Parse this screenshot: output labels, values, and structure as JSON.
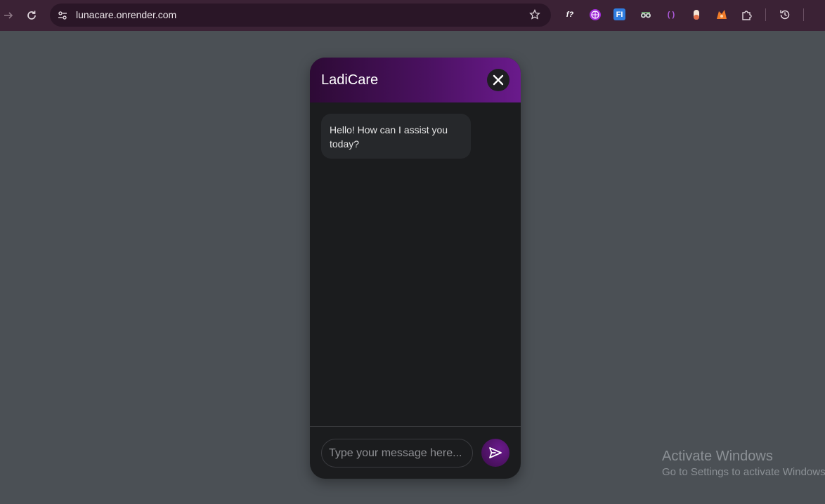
{
  "browser": {
    "url": "lunacare.onrender.com",
    "extensions": [
      {
        "icon": "formula-ext-icon",
        "label": "f?"
      },
      {
        "icon": "globe-ext-icon",
        "label": ""
      },
      {
        "icon": "fi-ext-icon",
        "label": "FI"
      },
      {
        "icon": "spy-ext-icon",
        "label": ""
      },
      {
        "icon": "brackets-ext-icon",
        "label": "( )"
      },
      {
        "icon": "pill-ext-icon",
        "label": ""
      },
      {
        "icon": "fox-ext-icon",
        "label": ""
      }
    ]
  },
  "chat": {
    "title": "LadiCare",
    "messages": [
      {
        "from": "bot",
        "text": "Hello! How can I assist you today?"
      }
    ],
    "input_placeholder": "Type your message here...",
    "input_value": ""
  },
  "watermark": {
    "title": "Activate Windows",
    "subtitle": "Go to Settings to activate Windows."
  },
  "colors": {
    "page_bg": "#4b5055",
    "browser_bar": "#3b2235",
    "header_gradient_start": "#2d0a35",
    "header_gradient_end": "#6a1a8c",
    "chat_bg": "#1b1c1e",
    "bubble_bg": "#26282b"
  }
}
